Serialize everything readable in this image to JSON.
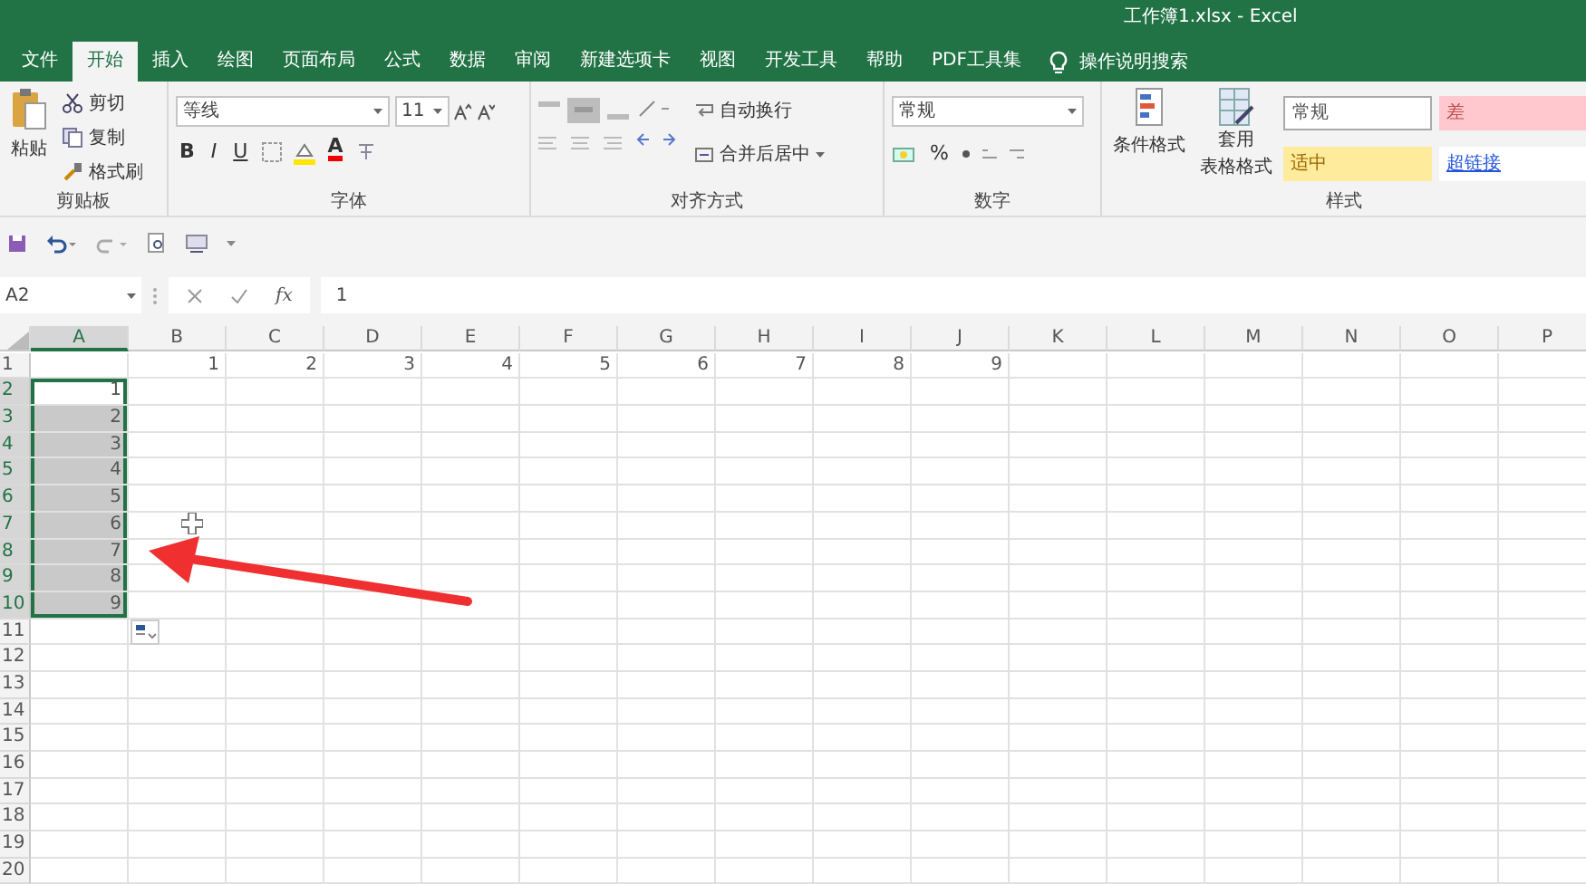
{
  "window": {
    "title": "工作簿1.xlsx  -  Excel"
  },
  "ribbon": {
    "tabs": [
      {
        "label": "文件",
        "selected": false
      },
      {
        "label": "开始",
        "selected": true
      },
      {
        "label": "插入",
        "selected": false
      },
      {
        "label": "绘图",
        "selected": false
      },
      {
        "label": "页面布局",
        "selected": false
      },
      {
        "label": "公式",
        "selected": false
      },
      {
        "label": "数据",
        "selected": false
      },
      {
        "label": "审阅",
        "selected": false
      },
      {
        "label": "新建选项卡",
        "selected": false
      },
      {
        "label": "视图",
        "selected": false
      },
      {
        "label": "开发工具",
        "selected": false
      },
      {
        "label": "帮助",
        "selected": false
      },
      {
        "label": "PDF工具集",
        "selected": false
      }
    ],
    "tell_me": "操作说明搜索",
    "clipboard": {
      "paste": "粘贴",
      "cut": "剪切",
      "copy": "复制",
      "format_painter": "格式刷",
      "label": "剪贴板"
    },
    "font": {
      "name": "等线",
      "size": "11",
      "bold": "B",
      "italic": "I",
      "underline": "U",
      "font_color": "A",
      "label": "字体"
    },
    "alignment": {
      "wrap_text": "自动换行",
      "merge_center": "合并后居中",
      "label": "对齐方式"
    },
    "number": {
      "format": "常规",
      "percent": "%",
      "label": "数字"
    },
    "styles": {
      "conditional_formatting": "条件格式",
      "format_as_table": [
        "套用",
        "表格格式"
      ],
      "gallery": [
        {
          "label": "常规",
          "kind": "normal"
        },
        {
          "label": "差",
          "kind": "bad"
        },
        {
          "label": "适中",
          "kind": "neutral"
        },
        {
          "label": "超链接",
          "kind": "hyperlink"
        }
      ],
      "label": "样式"
    }
  },
  "formula_bar": {
    "name_box": "A2",
    "function_label": "fx",
    "value": "1"
  },
  "sheet": {
    "columns": [
      {
        "label": "A",
        "selected": true
      },
      {
        "label": "B",
        "selected": false
      },
      {
        "label": "C",
        "selected": false
      },
      {
        "label": "D",
        "selected": false
      },
      {
        "label": "E",
        "selected": false
      },
      {
        "label": "F",
        "selected": false
      },
      {
        "label": "G",
        "selected": false
      },
      {
        "label": "H",
        "selected": false
      },
      {
        "label": "I",
        "selected": false
      },
      {
        "label": "J",
        "selected": false
      },
      {
        "label": "K",
        "selected": false
      },
      {
        "label": "L",
        "selected": false
      },
      {
        "label": "M",
        "selected": false
      },
      {
        "label": "N",
        "selected": false
      },
      {
        "label": "O",
        "selected": false
      },
      {
        "label": "P",
        "selected": false
      }
    ],
    "rows": [
      {
        "header": "1",
        "selected": false,
        "active": false,
        "cells": [
          null,
          "1",
          "2",
          "3",
          "4",
          "5",
          "6",
          "7",
          "8",
          "9"
        ]
      },
      {
        "header": "2",
        "selected": true,
        "active": true,
        "cells": [
          "1"
        ]
      },
      {
        "header": "3",
        "selected": true,
        "active": false,
        "cells": [
          "2"
        ]
      },
      {
        "header": "4",
        "selected": true,
        "active": false,
        "cells": [
          "3"
        ]
      },
      {
        "header": "5",
        "selected": true,
        "active": false,
        "cells": [
          "4"
        ]
      },
      {
        "header": "6",
        "selected": true,
        "active": false,
        "cells": [
          "5"
        ]
      },
      {
        "header": "7",
        "selected": true,
        "active": false,
        "cells": [
          "6"
        ]
      },
      {
        "header": "8",
        "selected": true,
        "active": false,
        "cells": [
          "7"
        ]
      },
      {
        "header": "9",
        "selected": true,
        "active": false,
        "cells": [
          "8"
        ]
      },
      {
        "header": "10",
        "selected": true,
        "active": false,
        "cells": [
          "9"
        ]
      },
      {
        "header": "11",
        "selected": false,
        "active": false,
        "cells": []
      },
      {
        "header": "12",
        "selected": false,
        "active": false,
        "cells": []
      },
      {
        "header": "13",
        "selected": false,
        "active": false,
        "cells": []
      },
      {
        "header": "14",
        "selected": false,
        "active": false,
        "cells": []
      },
      {
        "header": "15",
        "selected": false,
        "active": false,
        "cells": []
      },
      {
        "header": "16",
        "selected": false,
        "active": false,
        "cells": []
      },
      {
        "header": "17",
        "selected": false,
        "active": false,
        "cells": []
      },
      {
        "header": "18",
        "selected": false,
        "active": false,
        "cells": []
      },
      {
        "header": "19",
        "selected": false,
        "active": false,
        "cells": []
      },
      {
        "header": "20",
        "selected": false,
        "active": false,
        "cells": []
      }
    ]
  }
}
